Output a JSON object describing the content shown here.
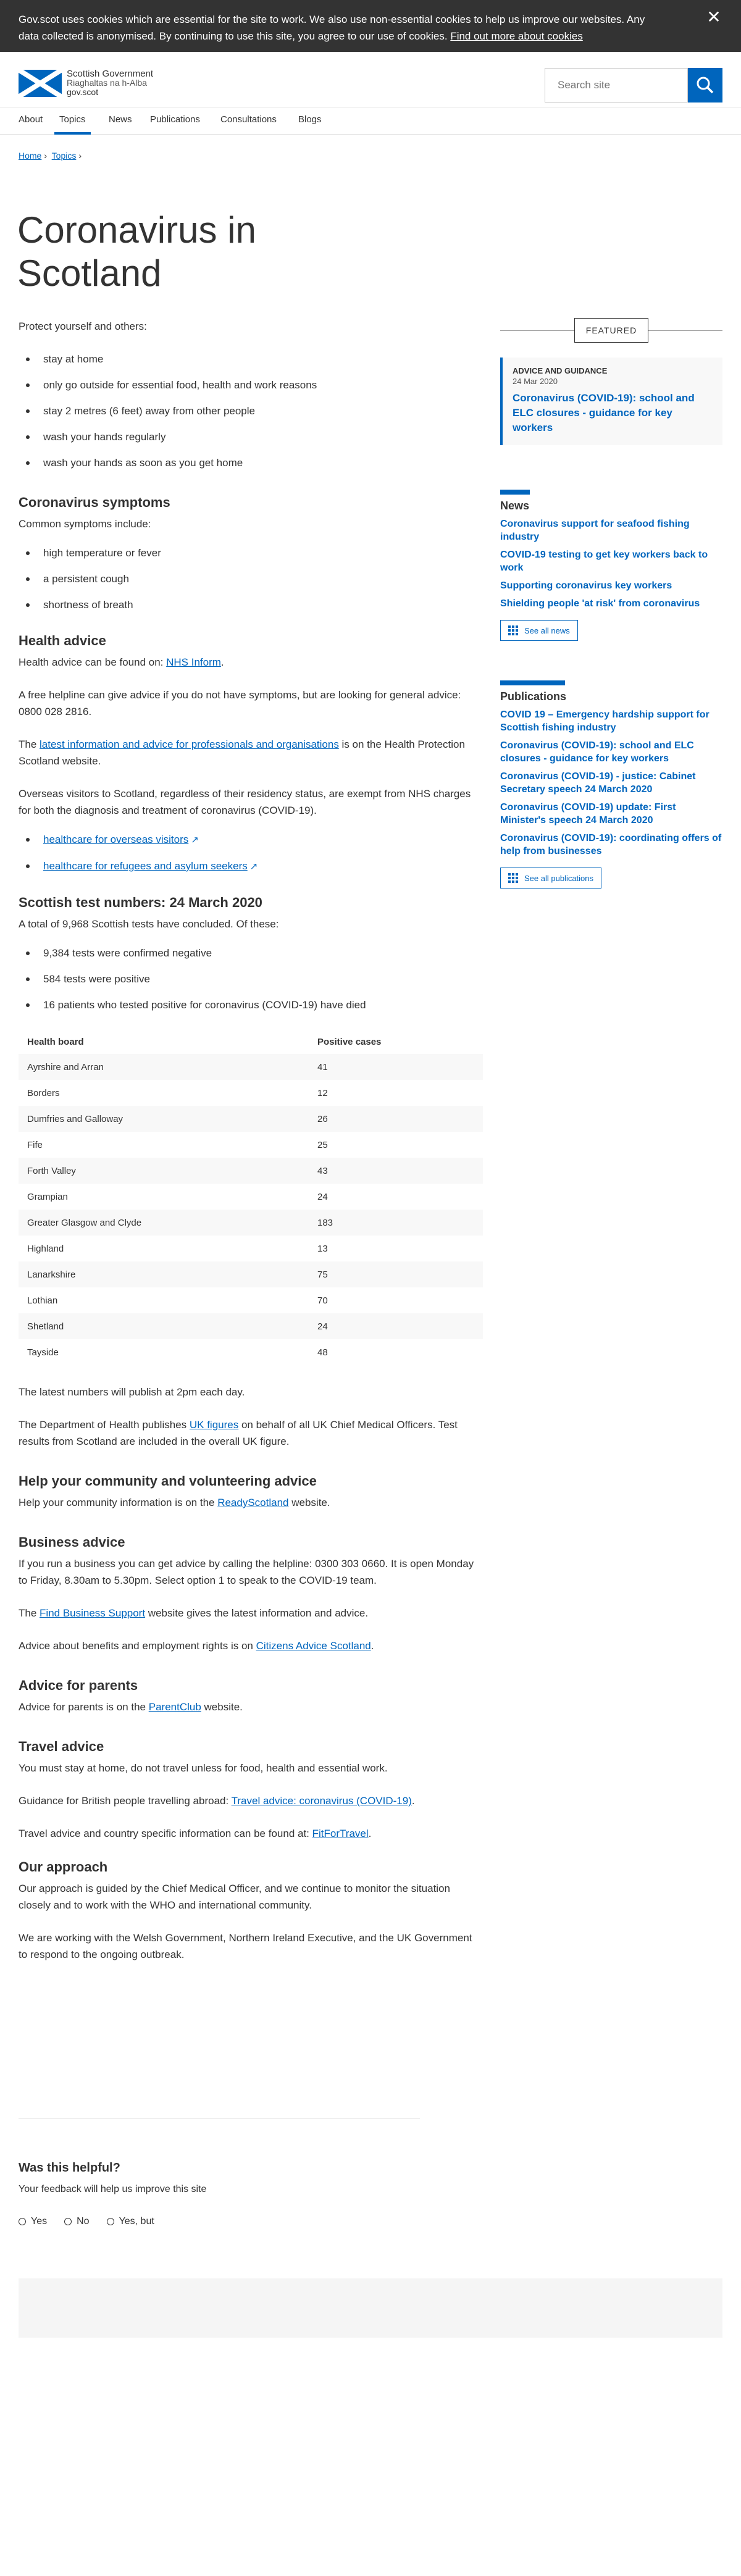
{
  "cookie": {
    "text": "Gov.scot uses cookies which are essential for the site to work. We also use non-essential cookies to help us improve our websites. Any data collected is anonymised. By continuing to use this site, you agree to our use of cookies.",
    "link": "Find out more about cookies",
    "close": "✕"
  },
  "logo": {
    "line1": "Scottish Government",
    "line2": "Riaghaltas na h-Alba",
    "line3": "gov.scot"
  },
  "search": {
    "placeholder": "Search site"
  },
  "nav": [
    "About",
    "Topics",
    "News",
    "Publications",
    "Consultations",
    "Blogs"
  ],
  "breadcrumb": [
    "Home",
    "Topics"
  ],
  "title": "Coronavirus in Scotland",
  "protect": {
    "intro": "Protect yourself and others:",
    "items": [
      "stay at home",
      "only go outside for essential food, health and work reasons",
      "stay 2 metres (6 feet) away from other people",
      "wash your hands regularly",
      "wash your hands as soon as you get home"
    ]
  },
  "symptoms": {
    "heading": "Coronavirus symptoms",
    "intro": "Common symptoms include:",
    "items": [
      "high temperature or fever",
      "a persistent cough",
      "shortness of breath"
    ]
  },
  "health": {
    "heading": "Health advice",
    "p1_text": "Health advice can be found on: ",
    "p1_link": "NHS Inform",
    "p2": "A free helpline can give advice if you do not have symptoms, but are looking for general advice: 0800 028 2816.",
    "p3_pre": "The ",
    "p3_link": "latest information and advice for professionals and organisations",
    "p3_post": " is on the Health Protection Scotland website.",
    "p4": "Overseas visitors to Scotland, regardless of their residency status, are exempt from NHS charges for both the diagnosis and treatment of coronavirus (COVID-19).",
    "links": [
      "healthcare for overseas visitors",
      "healthcare for refugees and asylum seekers"
    ]
  },
  "tests": {
    "heading": "Scottish test numbers: 24 March 2020",
    "intro": "A total of 9,968 Scottish tests have concluded. Of these:",
    "items": [
      "9,384 tests were confirmed negative",
      "584 tests were positive",
      "16 patients who tested positive for coronavirus (COVID-19) have died"
    ],
    "table_headers": [
      "Health board",
      "Positive cases"
    ],
    "rows": [
      [
        "Ayrshire and Arran",
        "41"
      ],
      [
        "Borders",
        "12"
      ],
      [
        "Dumfries and Galloway",
        "26"
      ],
      [
        "Fife",
        "25"
      ],
      [
        "Forth Valley",
        "43"
      ],
      [
        "Grampian",
        "24"
      ],
      [
        "Greater Glasgow and Clyde",
        "183"
      ],
      [
        "Highland",
        "13"
      ],
      [
        "Lanarkshire",
        "75"
      ],
      [
        "Lothian",
        "70"
      ],
      [
        "Shetland",
        "24"
      ],
      [
        "Tayside",
        "48"
      ]
    ],
    "p_publish": "The latest numbers will publish at 2pm each day.",
    "p_uk_pre": "The Department of Health publishes ",
    "p_uk_link": "UK figures",
    "p_uk_post": " on behalf of all UK Chief Medical Officers. Test results from Scotland are included in the overall UK figure."
  },
  "community": {
    "heading": "Help your community and volunteering advice",
    "pre": "Help your community information is on the ",
    "link": "ReadyScotland",
    "post": " website."
  },
  "business": {
    "heading": "Business advice",
    "p1": "If you run a business you can get advice by calling the helpline: 0300 303 0660.  It is open Monday to Friday, 8.30am to 5.30pm. Select option 1 to speak to the COVID-19 team.",
    "p2_pre": "The ",
    "p2_link": "Find Business Support",
    "p2_post": " website gives the latest information and advice.",
    "p3_pre": "Advice about benefits and employment rights is on ",
    "p3_link": "Citizens Advice Scotland",
    "p3_post": "."
  },
  "parents": {
    "heading": "Advice for parents",
    "pre": "Advice for parents is on the ",
    "link": "ParentClub",
    "post": " website."
  },
  "travel": {
    "heading": "Travel advice",
    "p1": "You must stay at home, do not travel unless for food, health and essential work.",
    "p2_pre": "Guidance for British people travelling abroad: ",
    "p2_link": "Travel advice: coronavirus (COVID-19)",
    "p2_post": ".",
    "p3_pre": "Travel advice and country specific information can be found at: ",
    "p3_link": "FitForTravel",
    "p3_post": "."
  },
  "approach": {
    "heading": "Our approach",
    "p1": "Our approach is guided by the Chief Medical Officer, and we continue to monitor the situation closely and to work with the WHO and international community.",
    "p2": "We are working with the Welsh Government, Northern Ireland Executive, and the UK Government to respond to the ongoing outbreak."
  },
  "sidebar": {
    "featured_label": "FEATURED",
    "featured": {
      "type": "Advice and guidance",
      "date": "24 Mar 2020",
      "title": "Coronavirus (COVID-19): school and ELC closures - guidance for key workers"
    },
    "news_title": "News",
    "news": [
      "Coronavirus support for seafood fishing industry",
      "COVID-19 testing to get key workers back to work",
      "Supporting coronavirus key workers",
      "Shielding people 'at risk' from coronavirus"
    ],
    "news_button": "See all news",
    "pubs_title": "Publications",
    "pubs": [
      "COVID 19 – Emergency hardship support for Scottish fishing industry",
      "Coronavirus (COVID-19): school and ELC closures - guidance for key workers",
      "Coronavirus (COVID-19) - justice: Cabinet Secretary speech 24 March 2020",
      "Coronavirus (COVID-19) update: First Minister's speech 24 March 2020",
      "Coronavirus (COVID-19): coordinating offers of help from businesses"
    ],
    "pubs_button": "See all publications"
  },
  "feedback": {
    "heading": "Was this helpful?",
    "sub": "Your feedback will help us improve this site",
    "options": [
      "Yes",
      "No",
      "Yes, but"
    ]
  }
}
